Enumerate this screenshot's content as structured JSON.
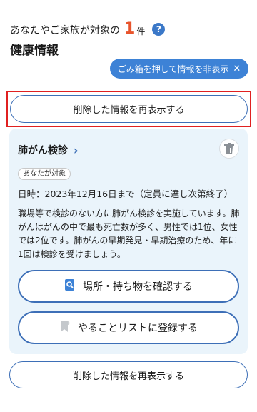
{
  "header": {
    "subtitle": "あなたやご家族が対象の",
    "count": "1",
    "count_unit": "件",
    "help_icon": "?",
    "title": "健康情報"
  },
  "hide_button": {
    "label": "ごみ箱を押して情報を非表示",
    "icon": "close-icon"
  },
  "redisplay_top": {
    "label": "削除した情報を再表示する"
  },
  "card": {
    "title": "肺がん検診",
    "badge": "あなたが対象",
    "date": "日時：2023年12月16日まで（定員に達し次第終了）",
    "description": "職場等で検診のない方に肺がん検診を実施しています。肺がんはがんの中で最も死亡数が多く、男性では1位、女性では2位です。肺がんの早期発見・早期治療のため、年に1回は検診を受けましょう。",
    "button_location": "場所・持ち物を確認する",
    "button_todo": "やることリストに登録する"
  },
  "redisplay_bottom": {
    "label": "削除した情報を再表示する"
  },
  "colors": {
    "accent": "#3d82d6",
    "count": "#e8542c",
    "highlight": "#e02020",
    "card_bg": "#eaf4fb"
  }
}
